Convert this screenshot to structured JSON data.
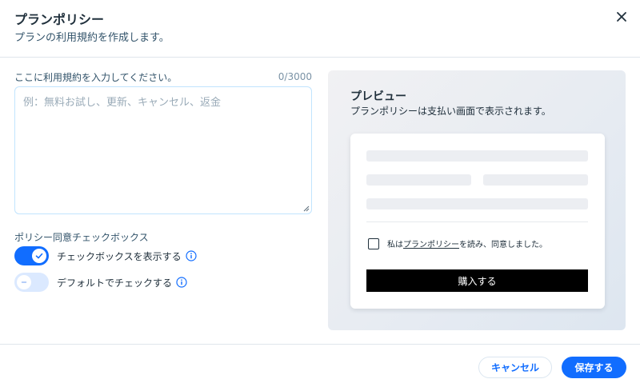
{
  "header": {
    "title": "プランポリシー",
    "subtitle": "プランの利用規約を作成します。"
  },
  "terms": {
    "label": "ここに利用規約を入力してください。",
    "counter": "0/3000",
    "value": "",
    "placeholder": "例：無料お試し、更新、キャンセル、返金"
  },
  "checkbox_section": {
    "label": "ポリシー同意チェックボックス",
    "toggles": [
      {
        "label": "チェックボックスを表示する",
        "on": true
      },
      {
        "label": "デフォルトでチェックする",
        "on": false
      }
    ]
  },
  "preview": {
    "title": "プレビュー",
    "subtitle": "プランポリシーは支払い画面で表示されます。",
    "agree_prefix": "私は",
    "agree_link": "プランポリシー",
    "agree_suffix": "を読み、同意しました。",
    "buy_label": "購入する"
  },
  "footer": {
    "cancel_label": "キャンセル",
    "save_label": "保存する"
  },
  "colors": {
    "accent": "#116dff",
    "toggle_off": "#dbe9ff",
    "text": "#20303c"
  },
  "icons": {
    "close": "close-icon",
    "info": "info-icon",
    "check": "check-icon"
  }
}
